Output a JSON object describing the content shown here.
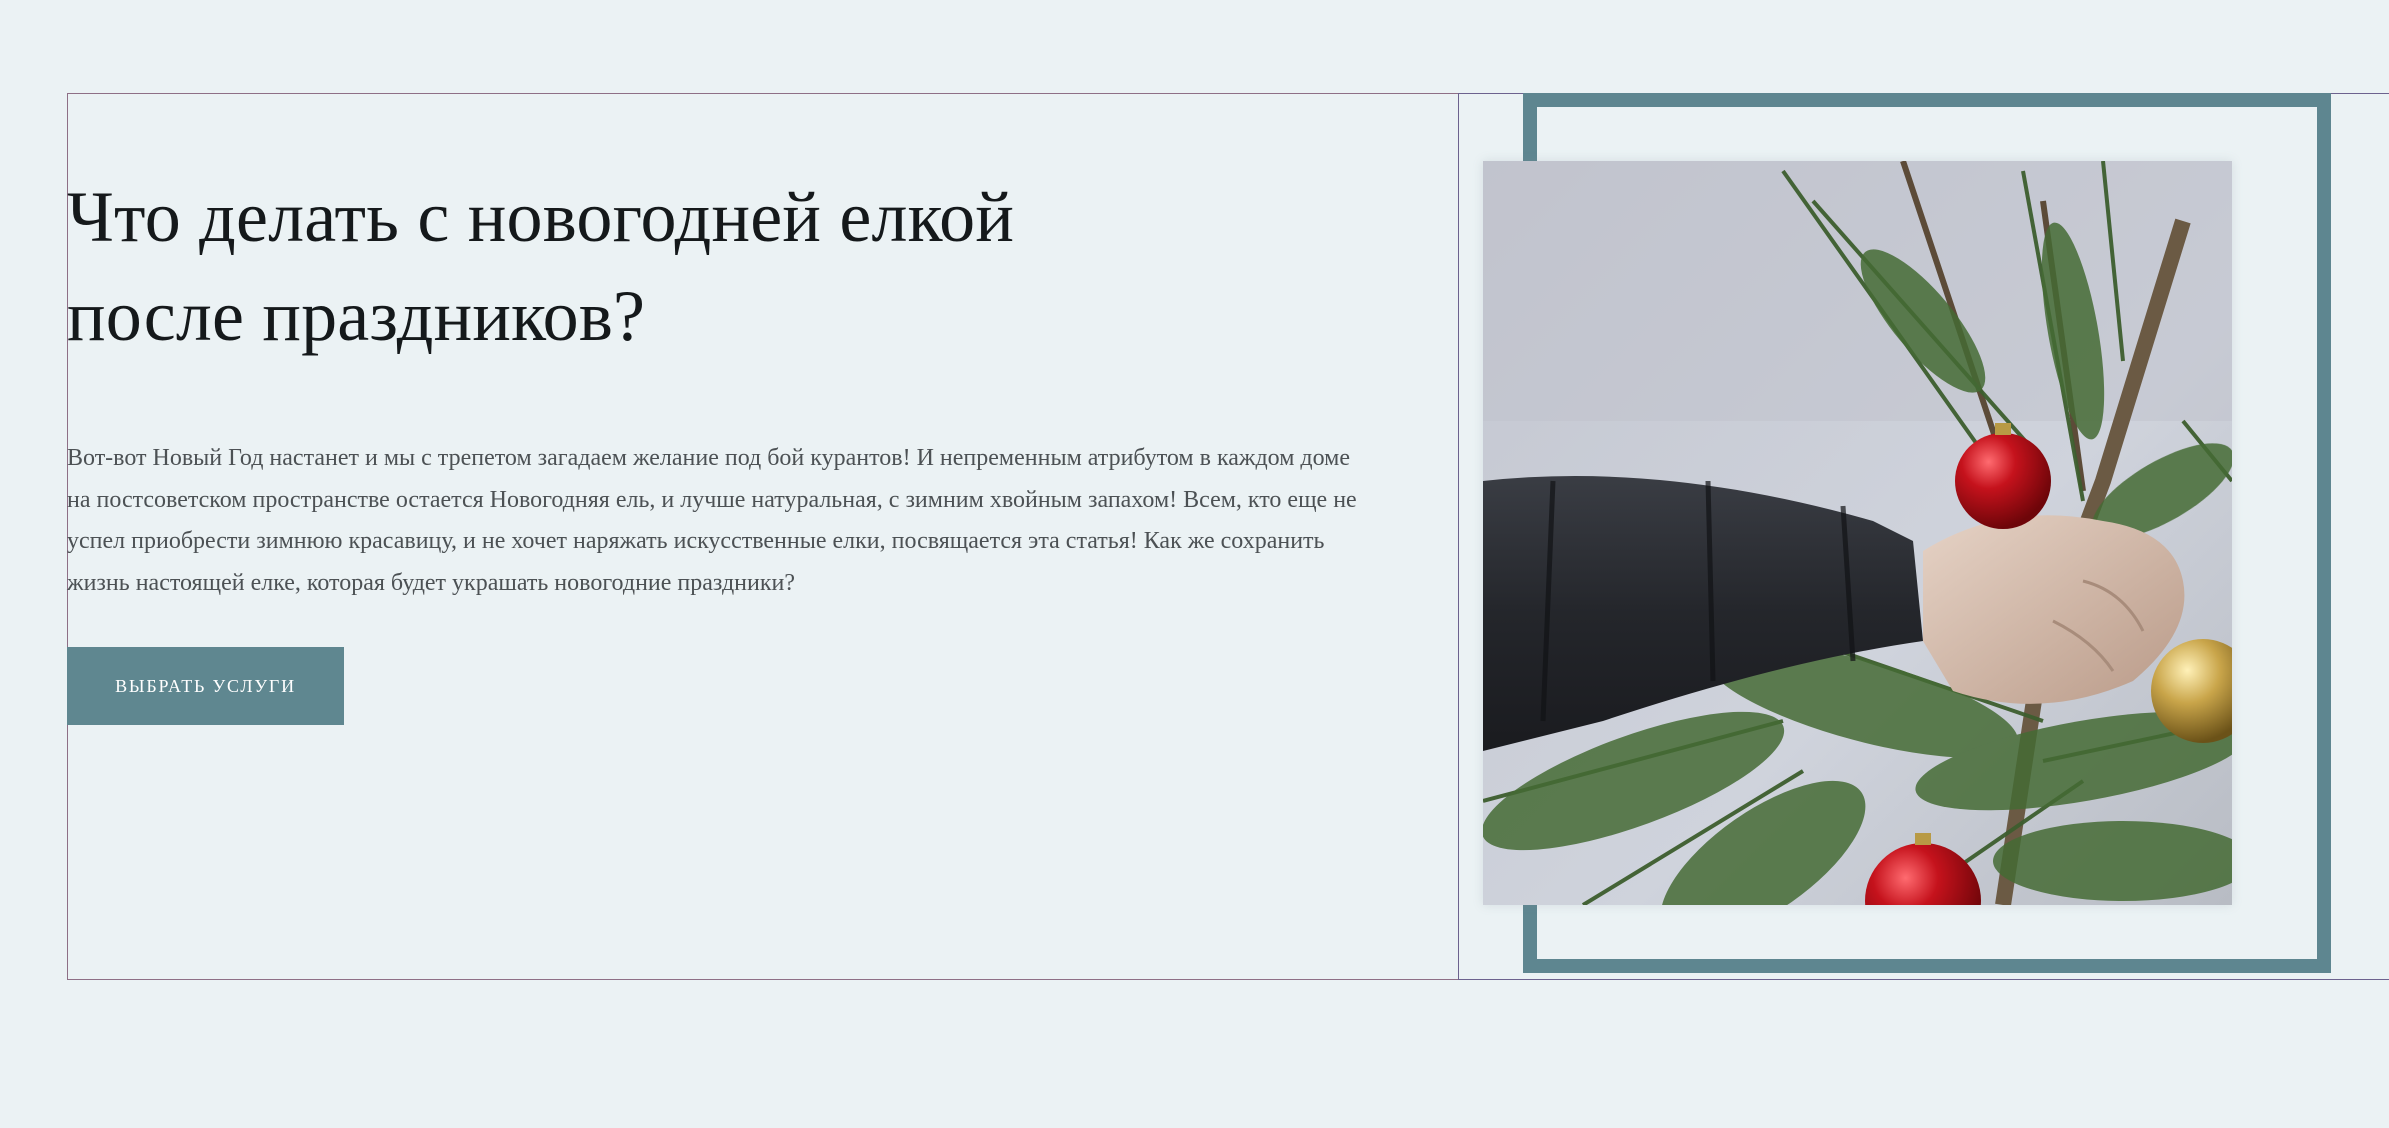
{
  "hero": {
    "title_line1": "Что делать с новогодней елкой",
    "title_line2": "после праздников?",
    "description": "Вот-вот Новый Год настанет и мы с трепетом загадаем желание под бой курантов! И непременным атрибутом в каждом доме на постсоветском пространстве остается Новогодняя ель, и лучше натуральная, с зимним хвойным запахом! Всем, кто еще не успел приобрести зимнюю красавицу, и не хочет наряжать искусственные елки, посвящается эта статья! Как же сохранить жизнь настоящей елке, которая будет украшать новогодние праздники?",
    "button_label": "ВЫБРАТЬ УСЛУГИ"
  },
  "colors": {
    "background": "#ebf2f4",
    "accent": "#5f8790",
    "heading": "#15191b",
    "body_text": "#4c5154"
  },
  "image": {
    "subject": "hand-holding-christmas-tree-branch-photo"
  }
}
